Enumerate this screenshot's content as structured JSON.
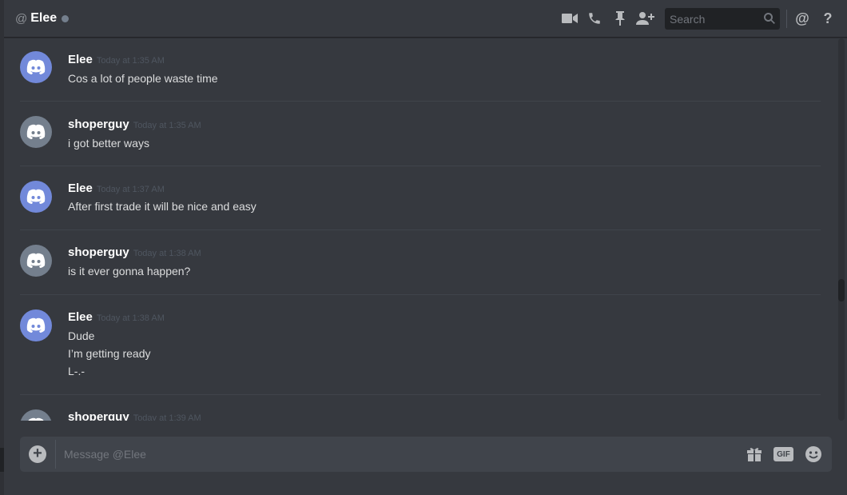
{
  "header": {
    "at_symbol": "@",
    "channel_name": "Elee",
    "status_color": "#747f8d",
    "icons": [
      "video-call-icon",
      "voice-call-icon",
      "pin-icon",
      "add-friend-icon",
      "mention-icon",
      "help-icon"
    ],
    "search_placeholder": "Search",
    "mention_symbol": "@",
    "help_symbol": "?"
  },
  "messages": [
    {
      "username": "Elee",
      "timestamp": "Today at 1:35 AM",
      "avatar_color": "#7289da",
      "lines": [
        "Cos a lot of people waste time"
      ]
    },
    {
      "username": "shoperguy",
      "timestamp": "Today at 1:35 AM",
      "avatar_color": "#747f8d",
      "lines": [
        "i got better ways"
      ]
    },
    {
      "username": "Elee",
      "timestamp": "Today at 1:37 AM",
      "avatar_color": "#7289da",
      "lines": [
        "After first trade it will be nice and easy"
      ]
    },
    {
      "username": "shoperguy",
      "timestamp": "Today at 1:38 AM",
      "avatar_color": "#747f8d",
      "lines": [
        "is it ever gonna happen?"
      ]
    },
    {
      "username": "Elee",
      "timestamp": "Today at 1:38 AM",
      "avatar_color": "#7289da",
      "lines": [
        "Dude",
        "I’m getting ready",
        "L-.-"
      ]
    },
    {
      "username": "shoperguy",
      "timestamp": "Today at 1:39 AM",
      "avatar_color": "#747f8d",
      "lines": []
    }
  ],
  "composer": {
    "placeholder": "Message @Elee",
    "upload_symbol": "+",
    "gif_label": "GIF",
    "icons": [
      "gift-icon",
      "gif-icon",
      "emoji-icon"
    ]
  },
  "colors": {
    "background": "#36393f",
    "blurple": "#7289da",
    "input_bg": "#40444b"
  }
}
